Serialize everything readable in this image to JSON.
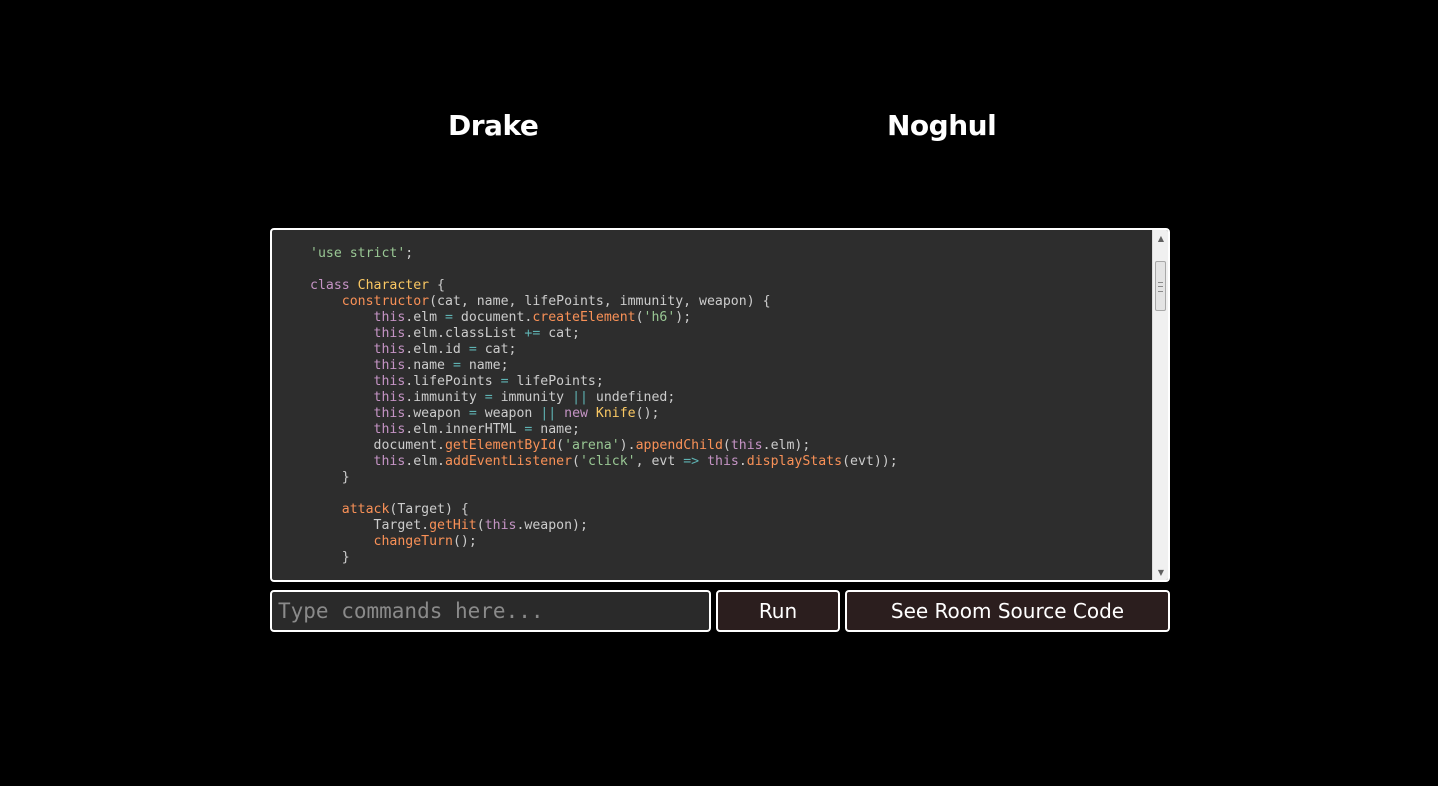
{
  "arena": {
    "characters": [
      {
        "name": "Drake"
      },
      {
        "name": "Noghul"
      }
    ]
  },
  "code_panel": {
    "lines": [
      [
        [
          "str",
          "'use strict'"
        ],
        [
          "pl",
          ";"
        ]
      ],
      [],
      [
        [
          "kw",
          "class "
        ],
        [
          "cls",
          "Character"
        ],
        [
          "pl",
          " {"
        ]
      ],
      [
        [
          "pl",
          "    "
        ],
        [
          "fn",
          "constructor"
        ],
        [
          "pl",
          "(cat, name, lifePoints, immunity, weapon) {"
        ]
      ],
      [
        [
          "pl",
          "        "
        ],
        [
          "kw",
          "this"
        ],
        [
          "pl",
          ".elm "
        ],
        [
          "op",
          "="
        ],
        [
          "pl",
          " document."
        ],
        [
          "fn",
          "createElement"
        ],
        [
          "pl",
          "("
        ],
        [
          "str",
          "'h6'"
        ],
        [
          "pl",
          ");"
        ]
      ],
      [
        [
          "pl",
          "        "
        ],
        [
          "kw",
          "this"
        ],
        [
          "pl",
          ".elm.classList "
        ],
        [
          "op",
          "+="
        ],
        [
          "pl",
          " cat;"
        ]
      ],
      [
        [
          "pl",
          "        "
        ],
        [
          "kw",
          "this"
        ],
        [
          "pl",
          ".elm.id "
        ],
        [
          "op",
          "="
        ],
        [
          "pl",
          " cat;"
        ]
      ],
      [
        [
          "pl",
          "        "
        ],
        [
          "kw",
          "this"
        ],
        [
          "pl",
          ".name "
        ],
        [
          "op",
          "="
        ],
        [
          "pl",
          " name;"
        ]
      ],
      [
        [
          "pl",
          "        "
        ],
        [
          "kw",
          "this"
        ],
        [
          "pl",
          ".lifePoints "
        ],
        [
          "op",
          "="
        ],
        [
          "pl",
          " lifePoints;"
        ]
      ],
      [
        [
          "pl",
          "        "
        ],
        [
          "kw",
          "this"
        ],
        [
          "pl",
          ".immunity "
        ],
        [
          "op",
          "="
        ],
        [
          "pl",
          " immunity "
        ],
        [
          "op",
          "||"
        ],
        [
          "pl",
          " undefined;"
        ]
      ],
      [
        [
          "pl",
          "        "
        ],
        [
          "kw",
          "this"
        ],
        [
          "pl",
          ".weapon "
        ],
        [
          "op",
          "="
        ],
        [
          "pl",
          " weapon "
        ],
        [
          "op",
          "||"
        ],
        [
          "pl",
          " "
        ],
        [
          "kw",
          "new "
        ],
        [
          "cls",
          "Knife"
        ],
        [
          "pl",
          "();"
        ]
      ],
      [
        [
          "pl",
          "        "
        ],
        [
          "kw",
          "this"
        ],
        [
          "pl",
          ".elm.innerHTML "
        ],
        [
          "op",
          "="
        ],
        [
          "pl",
          " name;"
        ]
      ],
      [
        [
          "pl",
          "        document."
        ],
        [
          "fn",
          "getElementById"
        ],
        [
          "pl",
          "("
        ],
        [
          "str",
          "'arena'"
        ],
        [
          "pl",
          ")."
        ],
        [
          "fn",
          "appendChild"
        ],
        [
          "pl",
          "("
        ],
        [
          "kw",
          "this"
        ],
        [
          "pl",
          ".elm);"
        ]
      ],
      [
        [
          "pl",
          "        "
        ],
        [
          "kw",
          "this"
        ],
        [
          "pl",
          ".elm."
        ],
        [
          "fn",
          "addEventListener"
        ],
        [
          "pl",
          "("
        ],
        [
          "str",
          "'click'"
        ],
        [
          "pl",
          ", evt "
        ],
        [
          "op",
          "=>"
        ],
        [
          "pl",
          " "
        ],
        [
          "kw",
          "this"
        ],
        [
          "pl",
          "."
        ],
        [
          "fn",
          "displayStats"
        ],
        [
          "pl",
          "(evt));"
        ]
      ],
      [
        [
          "pl",
          "    }"
        ]
      ],
      [],
      [
        [
          "pl",
          "    "
        ],
        [
          "fn",
          "attack"
        ],
        [
          "pl",
          "(Target) {"
        ]
      ],
      [
        [
          "pl",
          "        Target."
        ],
        [
          "fn",
          "getHit"
        ],
        [
          "pl",
          "("
        ],
        [
          "kw",
          "this"
        ],
        [
          "pl",
          ".weapon);"
        ]
      ],
      [
        [
          "pl",
          "        "
        ],
        [
          "fn",
          "changeTurn"
        ],
        [
          "pl",
          "();"
        ]
      ],
      [
        [
          "pl",
          "    }"
        ]
      ]
    ],
    "scroll_position": 0.05
  },
  "scrollbar": {
    "up_icon": "▲",
    "down_icon": "▼"
  },
  "command_bar": {
    "input_value": "",
    "input_placeholder": "Type commands here...",
    "run_label": "Run",
    "source_label": "See Room Source Code"
  },
  "colors": {
    "background": "#000000",
    "panel_background": "#2d2d2d",
    "button_background": "#2b1e1e",
    "string": "#99c794",
    "keyword": "#c594c5",
    "class_name": "#fac863",
    "function": "#f99157",
    "operator": "#5fb3b3",
    "plain": "#cccccc"
  }
}
